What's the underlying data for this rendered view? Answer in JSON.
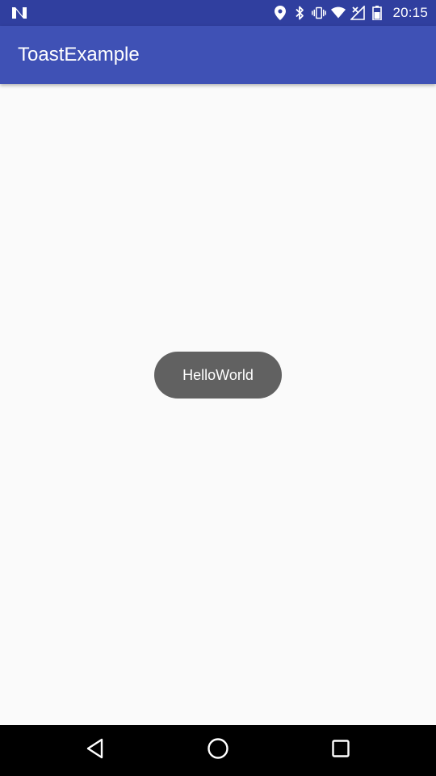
{
  "status_bar": {
    "time": "20:15",
    "icons": [
      "notification-n-icon",
      "location-icon",
      "bluetooth-icon",
      "vibrate-icon",
      "wifi-icon",
      "signal-no-data-icon",
      "battery-icon"
    ]
  },
  "app_bar": {
    "title": "ToastExample"
  },
  "toast": {
    "text": "HelloWorld"
  },
  "nav_bar": {
    "buttons": [
      "back-icon",
      "home-icon",
      "recents-icon"
    ]
  },
  "colors": {
    "status_bar": "#303f9f",
    "app_bar": "#3f51b5",
    "background": "#fafafa",
    "toast": "#616161",
    "nav_bar": "#000000"
  }
}
